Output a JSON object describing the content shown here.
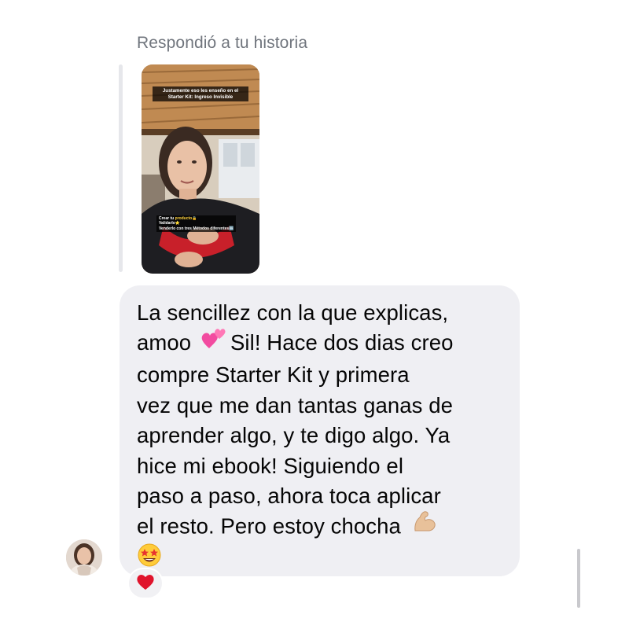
{
  "reply_context": {
    "header": "Respondió a tu historia"
  },
  "story": {
    "caption_line1": "Justamente eso les enseño en el",
    "caption_line2": "Starter Kit: Ingreso Invisible",
    "list_item1_prefix": "Crear tu ",
    "list_item1_highlight": "producto",
    "list_item1_suffix": "🔒",
    "list_item2": "Validarlo⭐",
    "list_item3": "Venderlo con tres Métodos diferentes🆒"
  },
  "message": {
    "lines": [
      "La sencillez con la que explicas,",
      "amoo",
      "Sil! Hace dos dias creo",
      "compre Starter Kit y primera",
      "vez que me dan tantas ganas de",
      "aprender algo, y te digo algo. Ya",
      "hice mi ebook! Siguiendo el",
      "paso a paso, ahora toca aplicar",
      "el resto. Pero estoy chocha"
    ],
    "emoji_after_amoo": "two-hearts-icon",
    "emoji_after_chocha": "flexed-biceps-icon",
    "emoji_last_line": "star-struck-icon"
  },
  "reaction": {
    "emoji": "red-heart-icon"
  },
  "colors": {
    "bubble": "#efeff3",
    "header_text": "#70757d",
    "reply_bar": "#e6e7eb",
    "reaction_heart": "#e0142c"
  }
}
